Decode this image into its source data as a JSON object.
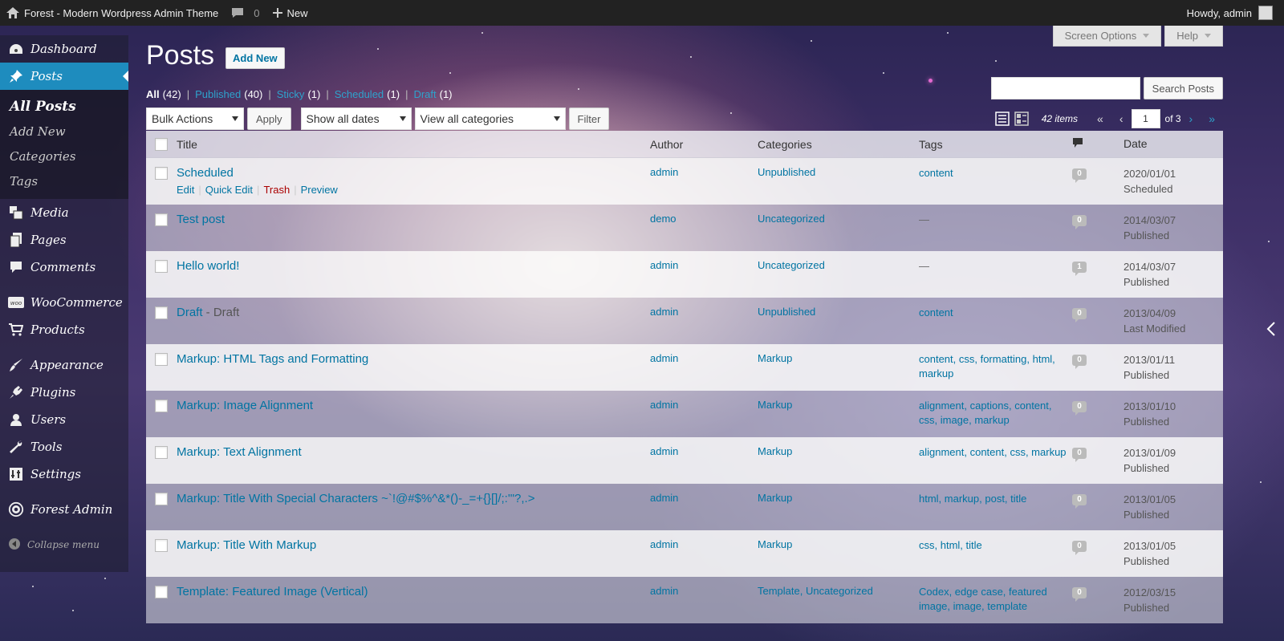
{
  "adminbar": {
    "site_title": "Forest - Modern Wordpress Admin Theme",
    "comments_count": "0",
    "new_label": "New",
    "howdy": "Howdy, admin"
  },
  "sidebar": {
    "items": [
      {
        "label": "Dashboard",
        "icon": "dashboard-icon"
      },
      {
        "label": "Posts",
        "icon": "pin-icon"
      },
      {
        "label": "Media",
        "icon": "media-icon"
      },
      {
        "label": "Pages",
        "icon": "pages-icon"
      },
      {
        "label": "Comments",
        "icon": "comments-icon"
      },
      {
        "label": "WooCommerce",
        "icon": "woo-icon"
      },
      {
        "label": "Products",
        "icon": "cart-icon"
      },
      {
        "label": "Appearance",
        "icon": "brush-icon"
      },
      {
        "label": "Plugins",
        "icon": "plugin-icon"
      },
      {
        "label": "Users",
        "icon": "user-icon"
      },
      {
        "label": "Tools",
        "icon": "wrench-icon"
      },
      {
        "label": "Settings",
        "icon": "settings-icon"
      },
      {
        "label": "Forest Admin",
        "icon": "gear-icon"
      }
    ],
    "submenu": [
      "All Posts",
      "Add New",
      "Categories",
      "Tags"
    ],
    "collapse": "Collapse menu"
  },
  "header": {
    "screen_options": "Screen Options",
    "help": "Help",
    "title": "Posts",
    "add_new": "Add New"
  },
  "filters": [
    {
      "label": "All",
      "count": "(42)"
    },
    {
      "label": "Published",
      "count": "(40)"
    },
    {
      "label": "Sticky",
      "count": "(1)"
    },
    {
      "label": "Scheduled",
      "count": "(1)"
    },
    {
      "label": "Draft",
      "count": "(1)"
    }
  ],
  "search": {
    "button": "Search Posts"
  },
  "tablenav": {
    "bulk_actions": "Bulk Actions",
    "apply": "Apply",
    "dates": "Show all dates",
    "categories": "View all categories",
    "filter": "Filter",
    "items": "42 items",
    "first": "«",
    "prev": "‹",
    "page": "1",
    "of": "of 3",
    "next": "›",
    "last": "»"
  },
  "table": {
    "headers": {
      "title": "Title",
      "author": "Author",
      "categories": "Categories",
      "tags": "Tags",
      "date": "Date"
    },
    "row_actions": {
      "edit": "Edit",
      "quick_edit": "Quick Edit",
      "trash": "Trash",
      "preview": "Preview"
    },
    "rows": [
      {
        "title": "Scheduled",
        "suffix": "",
        "author": "admin",
        "categories": "Unpublished",
        "tags": "content",
        "comments": "0",
        "date": "2020/01/01",
        "status": "Scheduled"
      },
      {
        "title": "Test post",
        "suffix": "",
        "author": "demo",
        "categories": "Uncategorized",
        "tags": "—",
        "comments": "0",
        "date": "2014/03/07",
        "status": "Published"
      },
      {
        "title": "Hello world!",
        "suffix": "",
        "author": "admin",
        "categories": "Uncategorized",
        "tags": "—",
        "comments": "1",
        "date": "2014/03/07",
        "status": "Published"
      },
      {
        "title": "Draft",
        "suffix": " - Draft",
        "author": "admin",
        "categories": "Unpublished",
        "tags": "content",
        "comments": "0",
        "date": "2013/04/09",
        "status": "Last Modified"
      },
      {
        "title": "Markup: HTML Tags and Formatting",
        "suffix": "",
        "author": "admin",
        "categories": "Markup",
        "tags": "content, css, formatting, html, markup",
        "comments": "0",
        "date": "2013/01/11",
        "status": "Published"
      },
      {
        "title": "Markup: Image Alignment",
        "suffix": "",
        "author": "admin",
        "categories": "Markup",
        "tags": "alignment, captions, content, css, image, markup",
        "comments": "0",
        "date": "2013/01/10",
        "status": "Published"
      },
      {
        "title": "Markup: Text Alignment",
        "suffix": "",
        "author": "admin",
        "categories": "Markup",
        "tags": "alignment, content, css, markup",
        "comments": "0",
        "date": "2013/01/09",
        "status": "Published"
      },
      {
        "title": "Markup: Title With Special Characters ~`!@#$%^&*()-_=+{}[]/;:'\"?,.>",
        "suffix": "",
        "author": "admin",
        "categories": "Markup",
        "tags": "html, markup, post, title",
        "comments": "0",
        "date": "2013/01/05",
        "status": "Published"
      },
      {
        "title": "Markup: Title With Markup",
        "suffix": "",
        "author": "admin",
        "categories": "Markup",
        "tags": "css, html, title",
        "comments": "0",
        "date": "2013/01/05",
        "status": "Published"
      },
      {
        "title": "Template: Featured Image (Vertical)",
        "suffix": "",
        "author": "admin",
        "categories": "Template, Uncategorized",
        "tags": "Codex, edge case, featured image, image, template",
        "comments": "0",
        "date": "2012/03/15",
        "status": "Published"
      }
    ]
  },
  "colors": {
    "accent": "#1e8cbe",
    "link": "#0074a2",
    "trash": "#aa0000"
  }
}
